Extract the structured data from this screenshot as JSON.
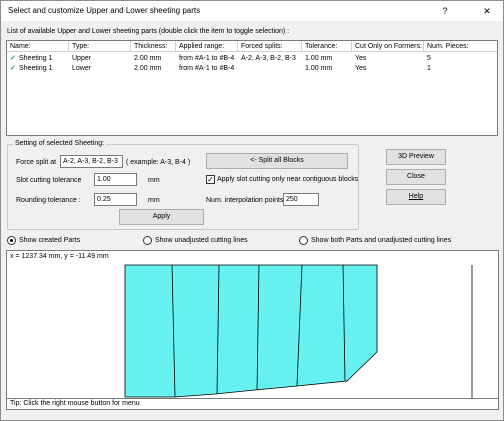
{
  "window": {
    "title": "Select and customize Upper and Lower sheeting parts",
    "help_glyph": "?",
    "close_glyph": "✕"
  },
  "list": {
    "caption": "List of available Upper and Lower sheeting parts (double click the item to toggle selection) :",
    "columns": [
      "Name:",
      "Type:",
      "Thickness:",
      "Applied range:",
      "Forced splits:",
      "Tolerance:",
      "Cut Only on Formers:",
      "Num. Pieces:"
    ],
    "rows": [
      [
        "Sheeting 1",
        "Upper",
        "2.00 mm",
        "from #A-1 to #B-4",
        "A-2, A-3, B-2, B-3",
        "1.00 mm",
        "Yes",
        "5"
      ],
      [
        "Sheeting 1",
        "Lower",
        "2.00 mm",
        "from #A-1 to #B-4",
        "",
        "1.00 mm",
        "Yes",
        "1"
      ]
    ],
    "check_glyph": "✓"
  },
  "settings": {
    "group_title": "Setting of selected Sheeting:",
    "force_split_label": "Force split at",
    "force_split_value": "A-2, A-3, B-2, B-3",
    "force_split_example": "( example: A-3, B-4 )",
    "split_all_button": "<- Split all Blocks",
    "slot_tol_label": "Slot cutting tolerance",
    "slot_tol_value": "1.00",
    "slot_tol_unit": "mm",
    "apply_slot_label": "Apply slot cutting only near contiguous blocks",
    "apply_slot_checked": true,
    "check_glyph": "✓",
    "rounding_label": "Rounding tolerance :",
    "rounding_value": "0.25",
    "rounding_unit": "mm",
    "num_interp_label": "Num. interpolation points :",
    "num_interp_value": "250",
    "apply_button": "Apply"
  },
  "side_buttons": {
    "preview": "3D Preview",
    "close": "Close",
    "help": "Help"
  },
  "view_options": {
    "show_created": "Show created Parts",
    "show_unadjusted": "Show unadjusted cutting lines",
    "show_both": "Show both Parts and unadjusted cutting lines",
    "selected": "show_created"
  },
  "canvas": {
    "coords": "x = 1237.34 mm, y = -11.49 mm",
    "part_fill": "#66f0f0",
    "part_stroke": "#000000"
  },
  "status_bar": {
    "tip": "Tip: Click the right mouse button for menu"
  }
}
